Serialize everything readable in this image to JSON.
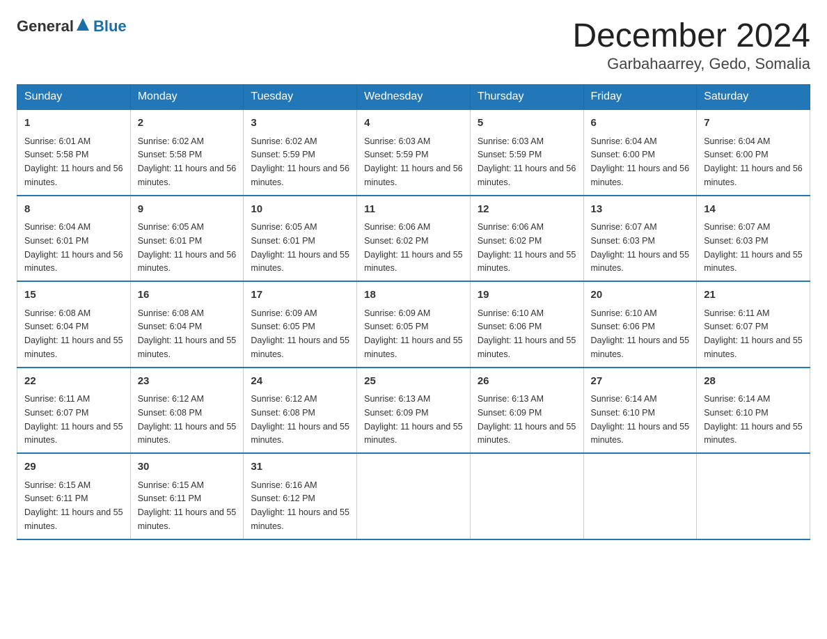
{
  "header": {
    "logo_general": "General",
    "logo_blue": "Blue",
    "month_title": "December 2024",
    "location": "Garbahaarrey, Gedo, Somalia"
  },
  "days_of_week": [
    "Sunday",
    "Monday",
    "Tuesday",
    "Wednesday",
    "Thursday",
    "Friday",
    "Saturday"
  ],
  "weeks": [
    [
      {
        "day": "1",
        "sunrise": "6:01 AM",
        "sunset": "5:58 PM",
        "daylight": "11 hours and 56 minutes."
      },
      {
        "day": "2",
        "sunrise": "6:02 AM",
        "sunset": "5:58 PM",
        "daylight": "11 hours and 56 minutes."
      },
      {
        "day": "3",
        "sunrise": "6:02 AM",
        "sunset": "5:59 PM",
        "daylight": "11 hours and 56 minutes."
      },
      {
        "day": "4",
        "sunrise": "6:03 AM",
        "sunset": "5:59 PM",
        "daylight": "11 hours and 56 minutes."
      },
      {
        "day": "5",
        "sunrise": "6:03 AM",
        "sunset": "5:59 PM",
        "daylight": "11 hours and 56 minutes."
      },
      {
        "day": "6",
        "sunrise": "6:04 AM",
        "sunset": "6:00 PM",
        "daylight": "11 hours and 56 minutes."
      },
      {
        "day": "7",
        "sunrise": "6:04 AM",
        "sunset": "6:00 PM",
        "daylight": "11 hours and 56 minutes."
      }
    ],
    [
      {
        "day": "8",
        "sunrise": "6:04 AM",
        "sunset": "6:01 PM",
        "daylight": "11 hours and 56 minutes."
      },
      {
        "day": "9",
        "sunrise": "6:05 AM",
        "sunset": "6:01 PM",
        "daylight": "11 hours and 56 minutes."
      },
      {
        "day": "10",
        "sunrise": "6:05 AM",
        "sunset": "6:01 PM",
        "daylight": "11 hours and 55 minutes."
      },
      {
        "day": "11",
        "sunrise": "6:06 AM",
        "sunset": "6:02 PM",
        "daylight": "11 hours and 55 minutes."
      },
      {
        "day": "12",
        "sunrise": "6:06 AM",
        "sunset": "6:02 PM",
        "daylight": "11 hours and 55 minutes."
      },
      {
        "day": "13",
        "sunrise": "6:07 AM",
        "sunset": "6:03 PM",
        "daylight": "11 hours and 55 minutes."
      },
      {
        "day": "14",
        "sunrise": "6:07 AM",
        "sunset": "6:03 PM",
        "daylight": "11 hours and 55 minutes."
      }
    ],
    [
      {
        "day": "15",
        "sunrise": "6:08 AM",
        "sunset": "6:04 PM",
        "daylight": "11 hours and 55 minutes."
      },
      {
        "day": "16",
        "sunrise": "6:08 AM",
        "sunset": "6:04 PM",
        "daylight": "11 hours and 55 minutes."
      },
      {
        "day": "17",
        "sunrise": "6:09 AM",
        "sunset": "6:05 PM",
        "daylight": "11 hours and 55 minutes."
      },
      {
        "day": "18",
        "sunrise": "6:09 AM",
        "sunset": "6:05 PM",
        "daylight": "11 hours and 55 minutes."
      },
      {
        "day": "19",
        "sunrise": "6:10 AM",
        "sunset": "6:06 PM",
        "daylight": "11 hours and 55 minutes."
      },
      {
        "day": "20",
        "sunrise": "6:10 AM",
        "sunset": "6:06 PM",
        "daylight": "11 hours and 55 minutes."
      },
      {
        "day": "21",
        "sunrise": "6:11 AM",
        "sunset": "6:07 PM",
        "daylight": "11 hours and 55 minutes."
      }
    ],
    [
      {
        "day": "22",
        "sunrise": "6:11 AM",
        "sunset": "6:07 PM",
        "daylight": "11 hours and 55 minutes."
      },
      {
        "day": "23",
        "sunrise": "6:12 AM",
        "sunset": "6:08 PM",
        "daylight": "11 hours and 55 minutes."
      },
      {
        "day": "24",
        "sunrise": "6:12 AM",
        "sunset": "6:08 PM",
        "daylight": "11 hours and 55 minutes."
      },
      {
        "day": "25",
        "sunrise": "6:13 AM",
        "sunset": "6:09 PM",
        "daylight": "11 hours and 55 minutes."
      },
      {
        "day": "26",
        "sunrise": "6:13 AM",
        "sunset": "6:09 PM",
        "daylight": "11 hours and 55 minutes."
      },
      {
        "day": "27",
        "sunrise": "6:14 AM",
        "sunset": "6:10 PM",
        "daylight": "11 hours and 55 minutes."
      },
      {
        "day": "28",
        "sunrise": "6:14 AM",
        "sunset": "6:10 PM",
        "daylight": "11 hours and 55 minutes."
      }
    ],
    [
      {
        "day": "29",
        "sunrise": "6:15 AM",
        "sunset": "6:11 PM",
        "daylight": "11 hours and 55 minutes."
      },
      {
        "day": "30",
        "sunrise": "6:15 AM",
        "sunset": "6:11 PM",
        "daylight": "11 hours and 55 minutes."
      },
      {
        "day": "31",
        "sunrise": "6:16 AM",
        "sunset": "6:12 PM",
        "daylight": "11 hours and 55 minutes."
      },
      null,
      null,
      null,
      null
    ]
  ]
}
